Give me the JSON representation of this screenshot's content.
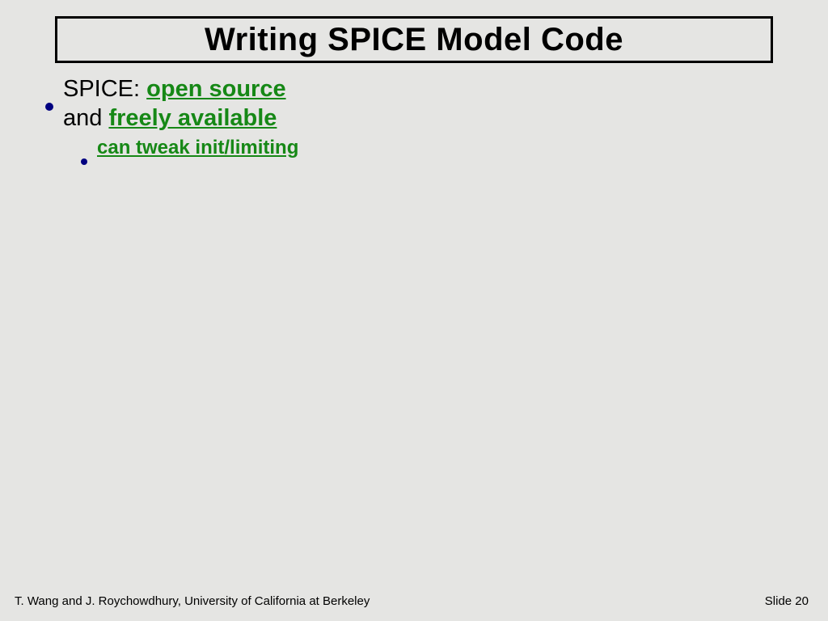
{
  "title": "Writing SPICE Model Code",
  "bullet1": {
    "prefix": "SPICE: ",
    "link1": "open source",
    "mid": "and ",
    "link2": "freely available"
  },
  "subbullet1": "can tweak init/limiting",
  "footer": {
    "left": "T. Wang and J. Roychowdhury,  University of California  at Berkeley",
    "right": "Slide 20"
  }
}
